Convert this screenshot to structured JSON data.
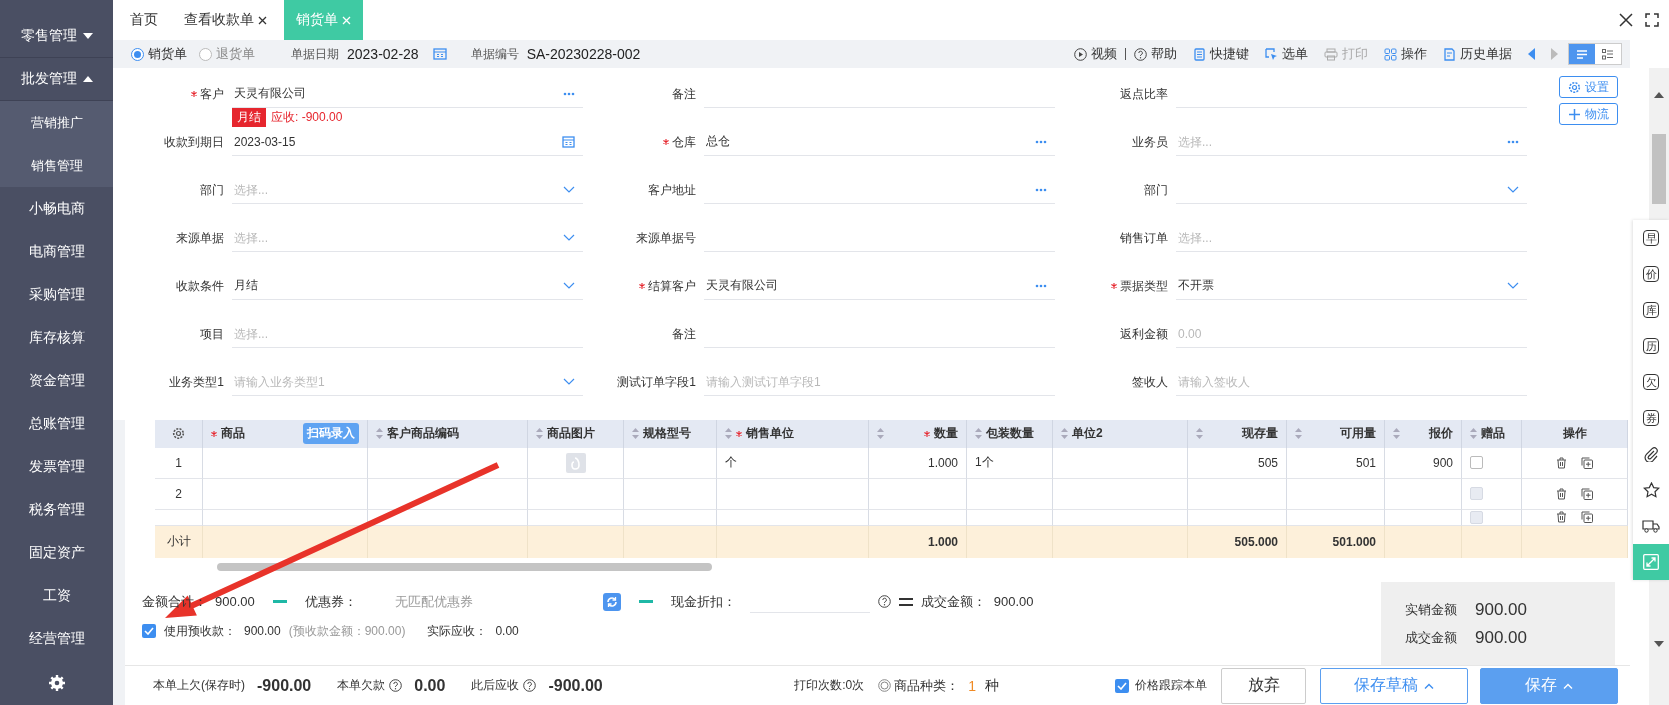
{
  "sidebar": {
    "items": [
      {
        "label": "零售管理",
        "kind": "group",
        "expanded": false
      },
      {
        "label": "批发管理",
        "kind": "group",
        "expanded": true
      },
      {
        "label": "营销推广",
        "kind": "sub"
      },
      {
        "label": "销售管理",
        "kind": "sub"
      },
      {
        "label": "小畅电商",
        "kind": "item"
      },
      {
        "label": "电商管理",
        "kind": "item"
      },
      {
        "label": "采购管理",
        "kind": "item"
      },
      {
        "label": "库存核算",
        "kind": "item"
      },
      {
        "label": "资金管理",
        "kind": "item"
      },
      {
        "label": "总账管理",
        "kind": "item"
      },
      {
        "label": "发票管理",
        "kind": "item"
      },
      {
        "label": "税务管理",
        "kind": "item"
      },
      {
        "label": "固定资产",
        "kind": "item"
      },
      {
        "label": "工资",
        "kind": "item"
      },
      {
        "label": "经营管理",
        "kind": "item"
      }
    ]
  },
  "tabs": [
    {
      "label": "首页",
      "closable": false,
      "selected": false
    },
    {
      "label": "查看收款单",
      "closable": true,
      "selected": false
    },
    {
      "label": "销货单",
      "closable": true,
      "selected": true
    }
  ],
  "doc_type": [
    {
      "label": "销货单",
      "selected": true
    },
    {
      "label": "退货单",
      "selected": false
    }
  ],
  "doc_date": {
    "label": "单据日期",
    "value": "2023-02-28"
  },
  "doc_number": {
    "label": "单据编号",
    "value": "SA-20230228-002"
  },
  "toolbar": [
    {
      "label": "视频",
      "disabled": false
    },
    {
      "label": "帮助",
      "disabled": false
    },
    {
      "label": "快捷键",
      "disabled": false
    },
    {
      "label": "选单",
      "disabled": false
    },
    {
      "label": "打印",
      "disabled": true
    },
    {
      "label": "操作",
      "disabled": false
    },
    {
      "label": "历史单据",
      "disabled": false
    }
  ],
  "view_modes": [
    {
      "kind": "form",
      "selected": true
    },
    {
      "kind": "list",
      "selected": false
    }
  ],
  "side_buttons": [
    {
      "label": "设置"
    },
    {
      "label": "物流"
    }
  ],
  "fields": [
    {
      "label": "客户",
      "required": true,
      "value": "天灵有限公司",
      "kind": "dots",
      "badge": "月结",
      "note": "应收: -900.00"
    },
    {
      "label": "备注",
      "required": false
    },
    {
      "label": "返点比率",
      "required": false
    },
    {
      "label": "收款到期日",
      "required": false,
      "value": "2023-03-15",
      "kind": "calendar"
    },
    {
      "label": "仓库",
      "required": true,
      "value": "总仓",
      "kind": "dots"
    },
    {
      "label": "业务员",
      "required": false,
      "placeholder": "选择...",
      "kind": "dots"
    },
    {
      "label": "部门",
      "required": false,
      "placeholder": "选择...",
      "kind": "chevron"
    },
    {
      "label": "客户地址",
      "required": false,
      "kind": "dots"
    },
    {
      "label": "部门",
      "required": false,
      "kind": "chevron"
    },
    {
      "label": "来源单据",
      "required": false,
      "placeholder": "选择...",
      "kind": "chevron"
    },
    {
      "label": "来源单据号",
      "required": false
    },
    {
      "label": "销售订单",
      "required": false,
      "placeholder": "选择..."
    },
    {
      "label": "收款条件",
      "required": false,
      "value": "月结",
      "kind": "chevron"
    },
    {
      "label": "结算客户",
      "required": true,
      "value": "天灵有限公司",
      "kind": "dots"
    },
    {
      "label": "票据类型",
      "required": true,
      "value": "不开票",
      "kind": "chevron"
    },
    {
      "label": "项目",
      "required": false,
      "placeholder": "选择..."
    },
    {
      "label": "备注",
      "required": false
    },
    {
      "label": "返利金额",
      "required": false,
      "placeholder": "0.00"
    },
    {
      "label": "业务类型1",
      "required": false,
      "placeholder": "请输入业务类型1",
      "kind": "chevron"
    },
    {
      "label": "测试订单字段1",
      "required": false,
      "placeholder": "请输入测试订单字段1"
    },
    {
      "label": "签收人",
      "required": false,
      "placeholder": "请输入签收人"
    }
  ],
  "table": {
    "columns": [
      {
        "label": "商品",
        "required": true,
        "sortable": false,
        "button": "扫码录入"
      },
      {
        "label": "客户商品编码",
        "required": false,
        "sortable": true
      },
      {
        "label": "商品图片",
        "required": false,
        "sortable": true
      },
      {
        "label": "规格型号",
        "required": false,
        "sortable": true
      },
      {
        "label": "销售单位",
        "required": true,
        "sortable": true
      },
      {
        "label": "数量",
        "required": true,
        "sortable": true
      },
      {
        "label": "包装数量",
        "required": false,
        "sortable": true
      },
      {
        "label": "单位2",
        "required": false,
        "sortable": true
      },
      {
        "label": "现存量",
        "required": false,
        "sortable": true
      },
      {
        "label": "可用量",
        "required": false,
        "sortable": true
      },
      {
        "label": "报价",
        "required": false,
        "sortable": true
      },
      {
        "label": "赠品",
        "required": false,
        "sortable": true
      },
      {
        "label": "操作",
        "required": false,
        "sortable": false
      }
    ],
    "rows": [
      {
        "index": "1",
        "has_image": true,
        "unit": "个",
        "qty": "1.000",
        "pack": "1个",
        "stock": "505",
        "avail": "501",
        "price": "900",
        "gift_checked": false,
        "gift_disabled": false
      },
      {
        "index": "2",
        "has_image": false,
        "gift_checked": false,
        "gift_disabled": true
      },
      {
        "has_image": false,
        "gift_checked": false,
        "gift_disabled": true
      }
    ],
    "subtotal": {
      "label": "小计",
      "qty": "1.000",
      "stock": "505.000",
      "avail": "501.000"
    }
  },
  "summary": {
    "total": {
      "label": "金额合计：",
      "value": "900.00"
    },
    "coupon": {
      "label": "优惠券：",
      "value": "无匹配优惠券"
    },
    "discount": {
      "label": "现金折扣："
    },
    "deal": {
      "label": "成交金额：",
      "value": "900.00"
    },
    "prepay": {
      "checked": true,
      "label": "使用预收款：",
      "value": "900.00",
      "note": "(预收款金额：900.00)"
    },
    "actual": {
      "label": "实际应收：",
      "value": "0.00"
    }
  },
  "totals_box": [
    {
      "label": "实销金额",
      "value": "900.00"
    },
    {
      "label": "成交金额",
      "value": "900.00"
    }
  ],
  "footer": {
    "balances": [
      {
        "label": "本单上欠(保存时)",
        "help": false,
        "value": "-900.00"
      },
      {
        "label": "本单欠款",
        "help": true,
        "value": "0.00"
      },
      {
        "label": "此后应收",
        "help": true,
        "value": "-900.00"
      }
    ],
    "print_count": "打印次数:0次",
    "kinds": {
      "label": "商品种类：",
      "value": "1",
      "unit": "种"
    },
    "price_track": {
      "label": "价格跟踪本单",
      "checked": true
    },
    "buttons": [
      {
        "label": "放弃",
        "kind": "plain"
      },
      {
        "label": "保存草稿",
        "kind": "outline"
      },
      {
        "label": "保存",
        "kind": "primary"
      }
    ]
  },
  "side_tools": [
    {
      "kind": "char",
      "text": "早"
    },
    {
      "kind": "char",
      "text": "价"
    },
    {
      "kind": "char",
      "text": "库"
    },
    {
      "kind": "char",
      "text": "历"
    },
    {
      "kind": "char",
      "text": "欠"
    },
    {
      "kind": "char",
      "text": "券"
    },
    {
      "kind": "link"
    },
    {
      "kind": "star"
    },
    {
      "kind": "truck"
    },
    {
      "kind": "expand"
    }
  ],
  "annotations": [
    {
      "kind": "arrow"
    }
  ]
}
